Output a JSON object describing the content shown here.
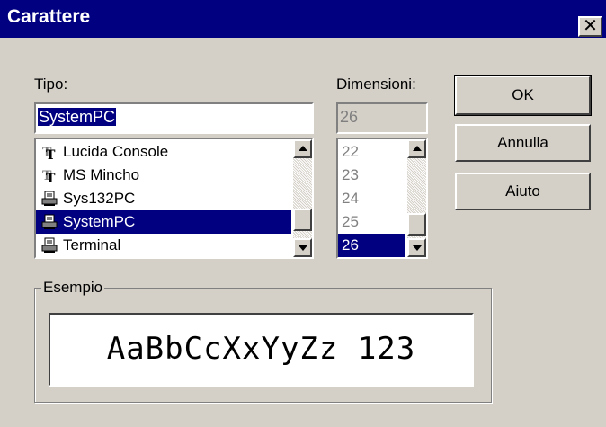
{
  "window": {
    "title": "Carattere",
    "close_glyph": "✕"
  },
  "font": {
    "label": "Tipo:",
    "value": "SystemPC",
    "items": [
      {
        "label": "Lucida Console",
        "icon": "truetype-font-icon",
        "selected": false
      },
      {
        "label": "MS Mincho",
        "icon": "truetype-font-icon",
        "selected": false
      },
      {
        "label": "Sys132PC",
        "icon": "printer-font-icon",
        "selected": false
      },
      {
        "label": "SystemPC",
        "icon": "printer-font-icon",
        "selected": true
      },
      {
        "label": "Terminal",
        "icon": "printer-font-icon",
        "selected": false
      }
    ]
  },
  "size": {
    "label": "Dimensioni:",
    "value": "26",
    "items": [
      "22",
      "23",
      "24",
      "25",
      "26"
    ],
    "selected": "26"
  },
  "buttons": {
    "ok": "OK",
    "cancel": "Annulla",
    "help": "Aiuto"
  },
  "sample": {
    "label": "Esempio",
    "text": "AaBbCcXxYyZz 123"
  },
  "colors": {
    "title_bar": "#000080",
    "selection": "#000080",
    "face": "#d4d0c8"
  }
}
